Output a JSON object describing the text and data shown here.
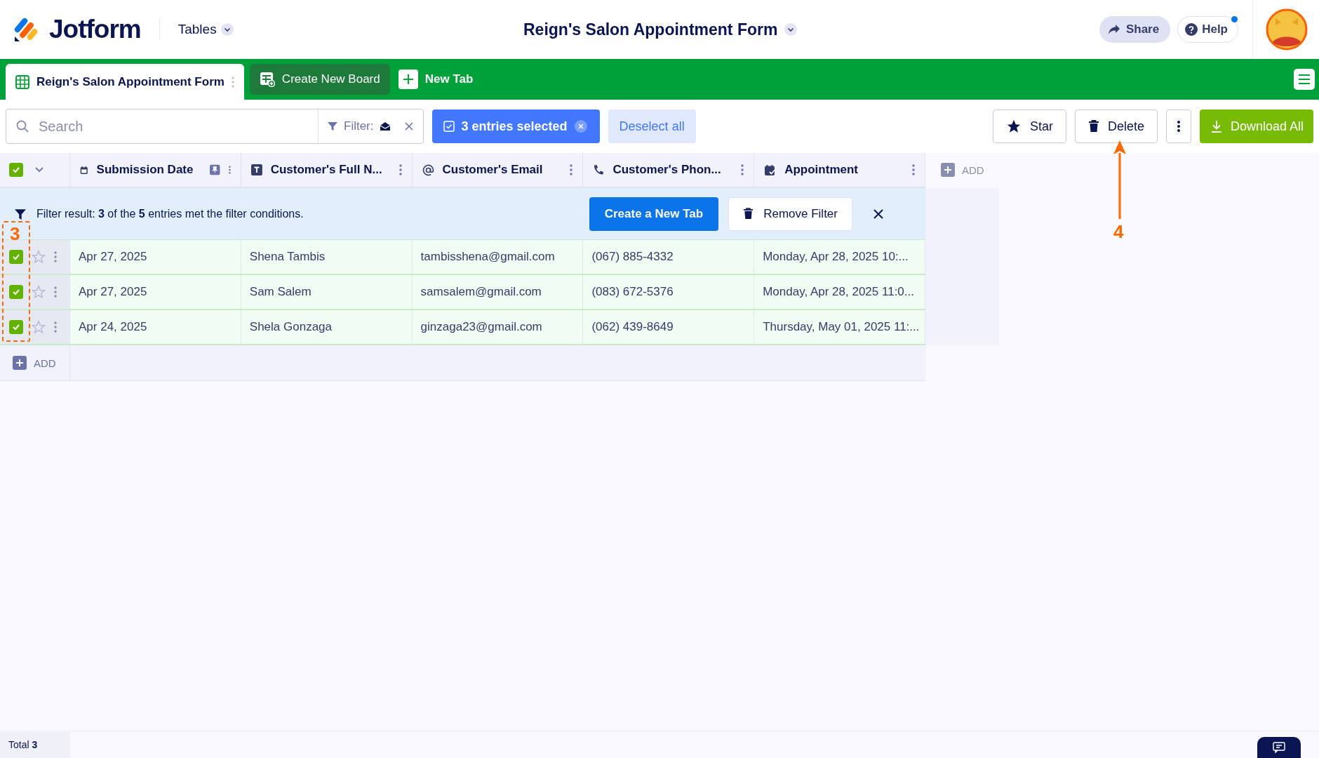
{
  "header": {
    "logo": "Jotform",
    "nav": "Tables",
    "title": "Reign's Salon Appointment Form",
    "share": "Share",
    "help": "Help",
    "help_notification": true
  },
  "tabs": [
    {
      "label": "Reign's Salon Appointment Form",
      "kind": "table",
      "selected": true
    },
    {
      "label": "Create New Board",
      "kind": "board",
      "selected": false
    },
    {
      "label": "New Tab",
      "kind": "new",
      "selected": false
    }
  ],
  "toolbar": {
    "search": {
      "placeholder": "Search"
    },
    "filter_label": "Filter:",
    "selection": "3 entries selected",
    "deselect": "Deselect all",
    "star": "Star",
    "delete": "Delete",
    "download": "Download All"
  },
  "table": {
    "all_checked": true,
    "columns": [
      {
        "label": "Submission Date",
        "kind": "date",
        "pinned": true
      },
      {
        "label": "Customer's Full N...",
        "kind": "text",
        "pinned": false
      },
      {
        "label": "Customer's Email",
        "kind": "email",
        "pinned": false
      },
      {
        "label": "Customer's Phon...",
        "kind": "phone",
        "pinned": false
      },
      {
        "label": "Appointment",
        "kind": "appointment",
        "pinned": false
      }
    ],
    "add_column": "ADD",
    "filter_banner": {
      "text": "Filter result: **3** of the **5** entries met the filter conditions.",
      "create_tab": "Create a New Tab",
      "remove_filter": "Remove Filter"
    },
    "rows": [
      {
        "checked": true,
        "starred": false,
        "cells": [
          "Apr 27, 2025",
          "Shena Tambis",
          "tambisshena@gmail.com",
          "(067) 885-4332",
          "Monday, Apr 28, 2025 10:..."
        ]
      },
      {
        "checked": true,
        "starred": false,
        "cells": [
          "Apr 27, 2025",
          "Sam Salem",
          "samsalem@gmail.com",
          "(083) 672-5376",
          "Monday, Apr 28, 2025 11:0..."
        ]
      },
      {
        "checked": true,
        "starred": false,
        "cells": [
          "Apr 24, 2025",
          "Shela Gonzaga",
          "ginzaga23@gmail.com",
          "(062) 439-8649",
          "Thursday, May 01, 2025 11:..."
        ]
      }
    ],
    "add_row": "ADD"
  },
  "footer": {
    "total": "Total **3**"
  },
  "annotations": [
    {
      "label": "3",
      "kind": "box"
    },
    {
      "label": "4",
      "kind": "arrow"
    }
  ]
}
